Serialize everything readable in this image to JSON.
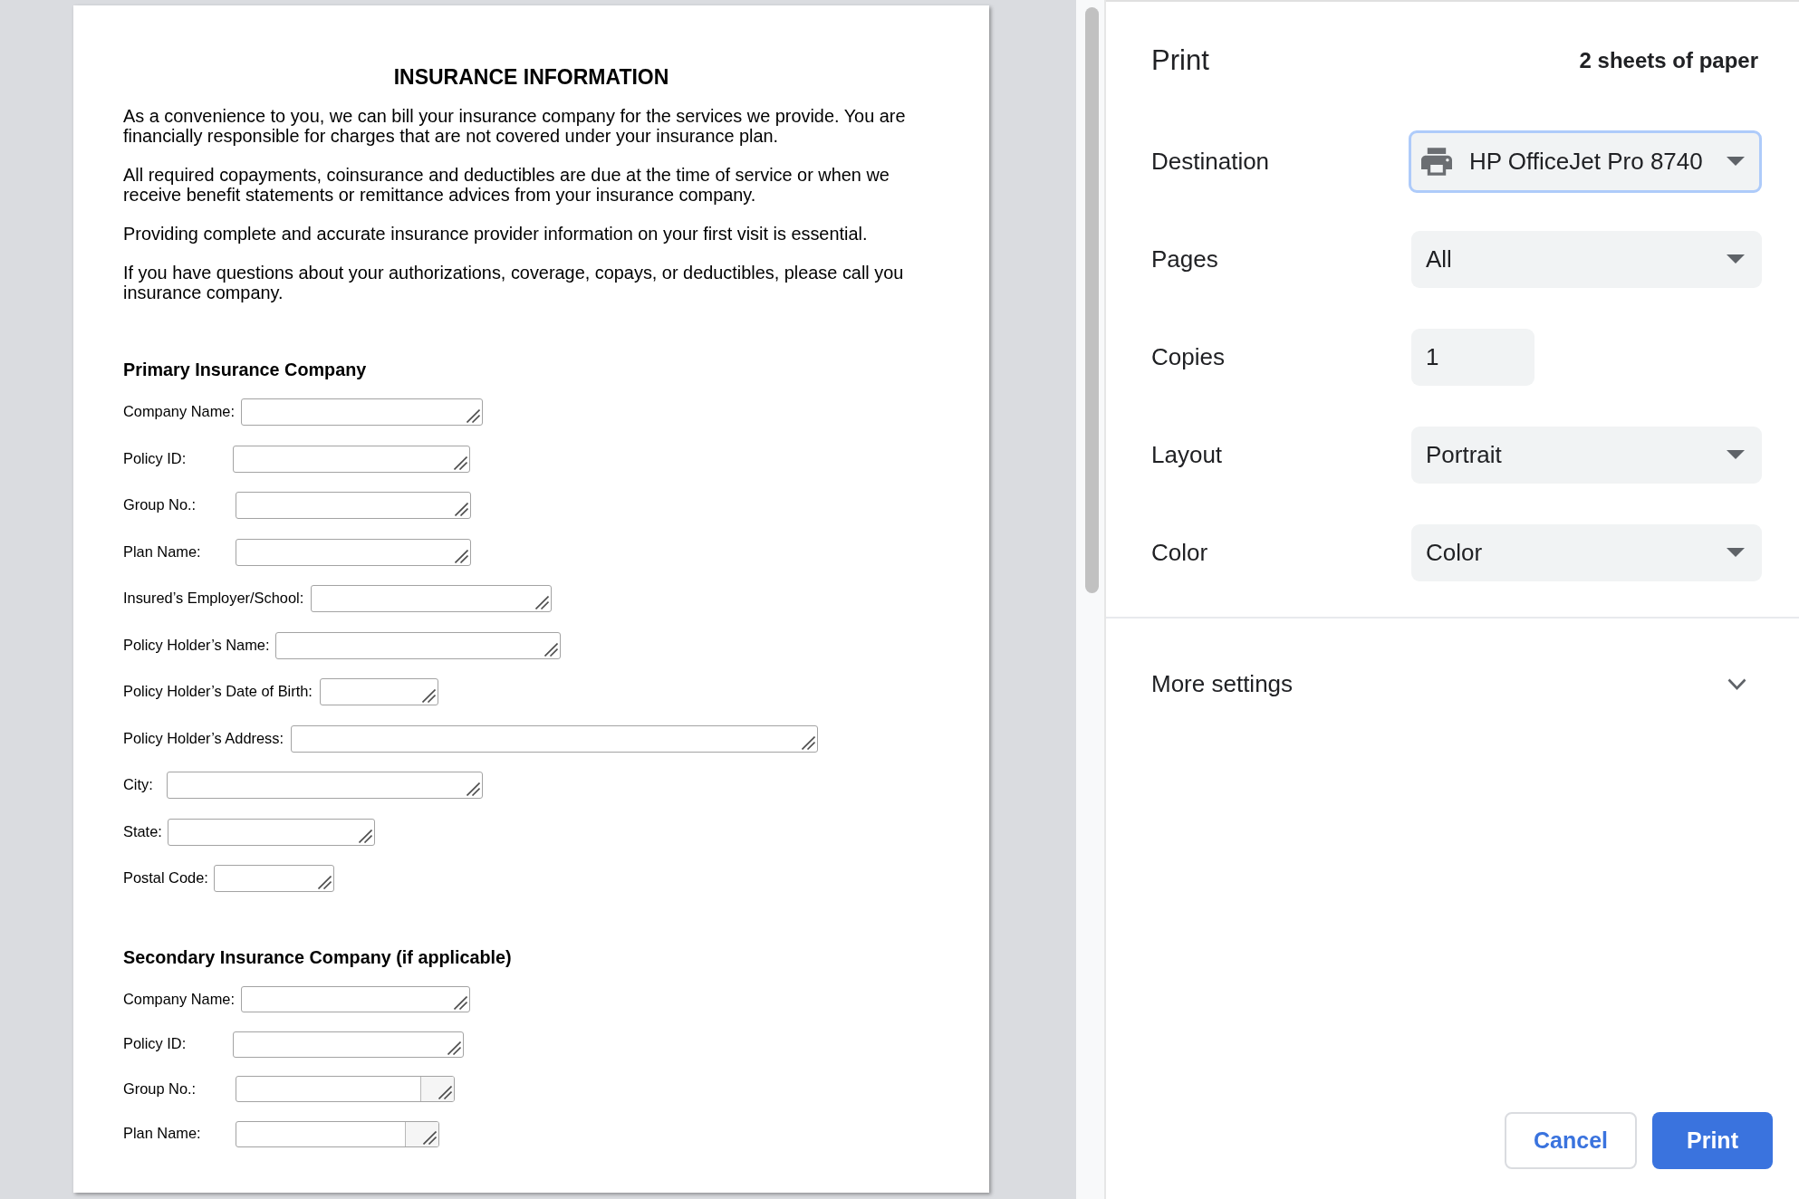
{
  "document": {
    "title": "INSURANCE INFORMATION",
    "paragraphs": [
      "As a convenience to you, we can bill your insurance company for the services we provide. You are financially responsible for charges that are not covered under your insurance plan.",
      "All required copayments, coinsurance and deductibles are due at the time of service or when we receive benefit statements or remittance advices from your insurance company.",
      "Providing complete and accurate insurance provider information on your first visit is essential.",
      "If you have questions about your authorizations, coverage, copays, or deductibles, please call you insurance company."
    ],
    "sections": [
      {
        "heading": "Primary Insurance Company",
        "fields": [
          {
            "label": "Company Name:",
            "scrollbar": false
          },
          {
            "label": "Policy ID:",
            "scrollbar": false
          },
          {
            "label": "Group No.:",
            "scrollbar": false
          },
          {
            "label": "Plan Name:",
            "scrollbar": false
          },
          {
            "label": "Insured’s Employer/School:",
            "scrollbar": false
          },
          {
            "label": "Policy Holder’s Name:",
            "scrollbar": false
          },
          {
            "label": "Policy Holder’s Date of Birth:",
            "scrollbar": false
          },
          {
            "label": "Policy Holder’s Address:",
            "scrollbar": false
          },
          {
            "label": "City:",
            "scrollbar": false
          },
          {
            "label": "State:",
            "scrollbar": false
          },
          {
            "label": "Postal Code:",
            "scrollbar": false
          }
        ]
      },
      {
        "heading": "Secondary Insurance Company (if applicable)",
        "fields": [
          {
            "label": "Company Name:",
            "scrollbar": false
          },
          {
            "label": "Policy ID:",
            "scrollbar": false
          },
          {
            "label": "Group No.:",
            "scrollbar": true
          },
          {
            "label": "Plan Name:",
            "scrollbar": true
          }
        ]
      }
    ]
  },
  "print_panel": {
    "title": "Print",
    "sheet_count": "2 sheets of paper",
    "settings": [
      {
        "label": "Destination",
        "kind": "destination",
        "value": "HP OfficeJet Pro 8740",
        "focused": true
      },
      {
        "label": "Pages",
        "kind": "select",
        "value": "All",
        "focused": false
      },
      {
        "label": "Copies",
        "kind": "number",
        "value": "1",
        "focused": false
      },
      {
        "label": "Layout",
        "kind": "select",
        "value": "Portrait",
        "focused": false
      },
      {
        "label": "Color",
        "kind": "select",
        "value": "Color",
        "focused": false
      }
    ],
    "more_settings": {
      "label": "More settings",
      "expanded": false
    },
    "buttons": [
      {
        "label": "Cancel",
        "kind": "secondary"
      },
      {
        "label": "Print",
        "kind": "primary"
      }
    ]
  }
}
